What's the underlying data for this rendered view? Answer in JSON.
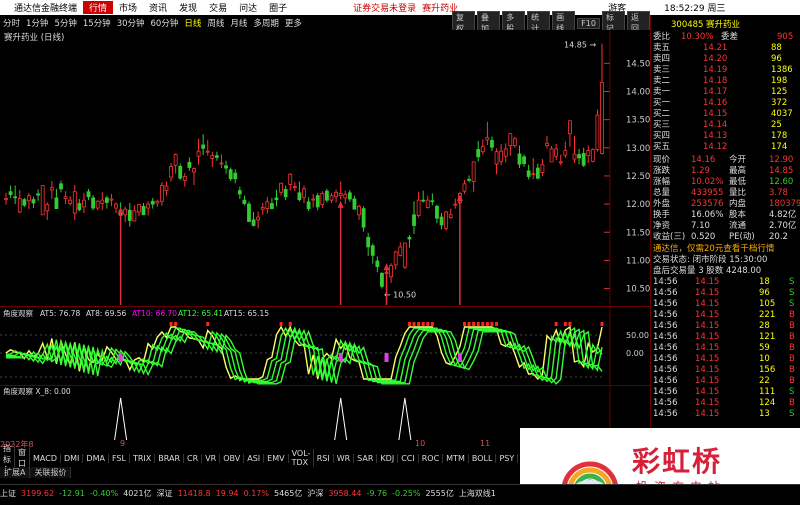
{
  "app": {
    "title": "通达信金融终端",
    "menu": [
      "行情",
      "市场",
      "资讯",
      "发现",
      "交易",
      "问达",
      "圈子"
    ],
    "active_menu": "行情",
    "notice": "证券交易未登录",
    "stock_link": "赛升药业",
    "guest": "游客",
    "time": "18:52:29 周三"
  },
  "toolbar": {
    "periods": [
      "分时",
      "1分钟",
      "5分钟",
      "15分钟",
      "30分钟",
      "60分钟",
      "日线",
      "周线",
      "月线",
      "多周期",
      "更多"
    ],
    "selected": "日线",
    "right_buttons": [
      "复权",
      "叠加",
      "多股",
      "统计",
      "画线",
      "F10",
      "标记",
      "返回"
    ]
  },
  "chart_title": "赛升药业 (日线)",
  "chart_data": {
    "type": "candlestick",
    "ylabels": [
      "14.50",
      "14.00",
      "13.50",
      "13.00",
      "12.50",
      "12.00",
      "11.50",
      "11.00",
      "10.50"
    ],
    "ylim": [
      10.35,
      14.95
    ],
    "high_label": "14.85",
    "low_label": "10.50",
    "candles": [
      [
        12.08,
        12.2,
        11.99,
        12.1
      ],
      [
        12.22,
        12.33,
        12.11,
        12.17
      ],
      [
        12.13,
        12.33,
        12.0,
        12.12
      ],
      [
        11.86,
        12.25,
        11.84,
        12.1
      ],
      [
        12.08,
        12.11,
        11.95,
        11.98
      ],
      [
        12.06,
        12.2,
        11.91,
        12.15
      ],
      [
        12.08,
        12.13,
        11.93,
        12.02
      ],
      [
        12.18,
        12.26,
        12.06,
        12.16
      ],
      [
        11.81,
        12.33,
        11.81,
        12.33
      ],
      [
        11.88,
        12.03,
        11.72,
        11.99
      ],
      [
        12.25,
        12.41,
        12.09,
        12.29
      ],
      [
        12.11,
        12.27,
        11.92,
        11.92
      ],
      [
        12.36,
        12.42,
        12.21,
        12.27
      ],
      [
        12.1,
        12.23,
        12.0,
        12.13
      ],
      [
        12.01,
        12.14,
        11.97,
        12.07
      ],
      [
        11.84,
        12.34,
        11.72,
        12.22
      ],
      [
        12.01,
        12.09,
        11.87,
        11.9
      ],
      [
        11.95,
        12.2,
        11.84,
        12.07
      ],
      [
        12.22,
        12.27,
        12.07,
        12.13
      ],
      [
        12.11,
        12.16,
        11.89,
        11.93
      ],
      [
        11.93,
        12.07,
        11.89,
        12.05
      ],
      [
        12.01,
        12.21,
        11.89,
        12.07
      ],
      [
        12.11,
        12.15,
        11.92,
        12.03
      ],
      [
        12.07,
        12.18,
        11.96,
        12.09
      ],
      [
        11.93,
        12.03,
        11.84,
        12.0
      ],
      [
        11.89,
        12.03,
        11.74,
        11.8
      ],
      [
        11.81,
        11.95,
        11.68,
        11.91
      ],
      [
        11.89,
        12.02,
        11.6,
        11.71
      ],
      [
        11.7,
        11.98,
        11.7,
        11.88
      ],
      [
        11.86,
        12.0,
        11.79,
        11.99
      ],
      [
        11.96,
        12.02,
        11.81,
        11.81
      ],
      [
        11.93,
        12.05,
        11.8,
        12.0
      ],
      [
        12.05,
        12.11,
        11.92,
        12.0
      ],
      [
        12.02,
        12.08,
        11.95,
        12.05
      ],
      [
        12.05,
        12.39,
        11.97,
        12.33
      ],
      [
        12.24,
        12.4,
        12.15,
        12.32
      ],
      [
        12.48,
        12.73,
        12.4,
        12.67
      ],
      [
        12.69,
        12.9,
        12.54,
        12.88
      ],
      [
        12.67,
        12.72,
        12.43,
        12.46
      ],
      [
        12.42,
        12.55,
        12.31,
        12.49
      ],
      [
        12.74,
        12.83,
        12.59,
        12.65
      ],
      [
        12.57,
        12.65,
        12.34,
        12.63
      ],
      [
        12.85,
        13.16,
        12.7,
        12.94
      ],
      [
        13.05,
        13.24,
        12.87,
        12.99
      ],
      [
        12.93,
        13.14,
        12.86,
        12.94
      ],
      [
        12.81,
        12.93,
        12.66,
        12.86
      ],
      [
        12.86,
        12.93,
        12.77,
        12.83
      ],
      [
        12.73,
        12.88,
        12.64,
        12.73
      ],
      [
        12.68,
        12.77,
        12.54,
        12.64
      ],
      [
        12.61,
        12.65,
        12.41,
        12.45
      ],
      [
        12.55,
        12.62,
        12.37,
        12.45
      ],
      [
        12.24,
        12.31,
        12.09,
        12.18
      ],
      [
        12.07,
        12.15,
        11.98,
        12.01
      ],
      [
        12.0,
        12.05,
        11.69,
        11.69
      ],
      [
        11.72,
        11.86,
        11.6,
        11.62
      ],
      [
        11.72,
        11.87,
        11.57,
        11.77
      ],
      [
        11.91,
        12.02,
        11.81,
        11.94
      ],
      [
        11.92,
        12.13,
        11.83,
        12.04
      ],
      [
        12.01,
        12.11,
        11.91,
        11.92
      ],
      [
        12.11,
        12.25,
        11.96,
        12.08
      ],
      [
        12.21,
        12.38,
        12.15,
        12.37
      ],
      [
        12.26,
        12.33,
        12.07,
        12.13
      ],
      [
        12.35,
        12.55,
        12.24,
        12.53
      ],
      [
        12.3,
        12.39,
        12.23,
        12.31
      ],
      [
        12.2,
        12.4,
        12.05,
        12.08
      ],
      [
        12.12,
        12.33,
        12.02,
        12.27
      ],
      [
        12.04,
        12.12,
        11.88,
        11.92
      ],
      [
        12.08,
        12.18,
        11.94,
        12.09
      ],
      [
        12.15,
        12.2,
        11.89,
        11.95
      ],
      [
        11.99,
        12.23,
        11.93,
        12.19
      ],
      [
        12.23,
        12.27,
        12.03,
        12.07
      ],
      [
        12.07,
        12.2,
        12.02,
        12.15
      ],
      [
        12.13,
        12.26,
        12.03,
        12.21
      ],
      [
        12.15,
        12.4,
        12.08,
        12.19
      ],
      [
        12.11,
        12.24,
        12.0,
        12.17
      ],
      [
        12.2,
        12.25,
        12.04,
        12.09
      ],
      [
        12.09,
        12.15,
        11.91,
        11.91
      ],
      [
        11.81,
        11.99,
        11.72,
        11.96
      ],
      [
        11.92,
        11.96,
        11.51,
        11.59
      ],
      [
        11.41,
        11.49,
        11.08,
        11.24
      ],
      [
        11.26,
        11.3,
        10.94,
        11.09
      ],
      [
        10.99,
        11.07,
        10.79,
        10.89
      ],
      [
        10.77,
        10.79,
        10.5,
        10.54
      ],
      [
        10.77,
        10.94,
        10.74,
        10.79
      ],
      [
        10.71,
        10.95,
        10.6,
        10.91
      ],
      [
        10.92,
        11.17,
        10.84,
        11.15
      ],
      [
        11.09,
        11.32,
        11.07,
        11.24
      ],
      [
        10.88,
        11.31,
        10.85,
        11.31
      ],
      [
        11.41,
        11.45,
        11.23,
        11.38
      ],
      [
        11.81,
        12.05,
        11.47,
        11.62
      ],
      [
        11.8,
        12.22,
        11.76,
        12.07
      ],
      [
        12.07,
        12.24,
        12.03,
        12.06
      ],
      [
        11.94,
        12.15,
        11.92,
        12.07
      ],
      [
        12.06,
        12.19,
        11.98,
        12.05
      ],
      [
        11.96,
        11.99,
        11.66,
        11.75
      ],
      [
        11.77,
        11.84,
        11.55,
        11.63
      ],
      [
        11.57,
        11.88,
        11.53,
        11.86
      ],
      [
        11.76,
        11.92,
        11.74,
        11.81
      ],
      [
        11.99,
        12.1,
        11.92,
        12.0
      ],
      [
        12.02,
        12.22,
        11.97,
        12.19
      ],
      [
        12.23,
        12.43,
        12.18,
        12.36
      ],
      [
        12.44,
        12.51,
        12.39,
        12.43
      ],
      [
        12.4,
        12.76,
        12.22,
        12.75
      ],
      [
        12.97,
        13.12,
        12.76,
        12.84
      ],
      [
        12.93,
        13.15,
        12.88,
        13.02
      ],
      [
        13.14,
        13.46,
        13.05,
        13.18
      ],
      [
        13.13,
        13.2,
        12.94,
        13.01
      ],
      [
        12.71,
        12.99,
        12.53,
        12.93
      ],
      [
        12.76,
        13.07,
        12.69,
        12.94
      ],
      [
        12.85,
        13.08,
        12.74,
        12.98
      ],
      [
        13.04,
        13.26,
        12.86,
        13.25
      ],
      [
        13.04,
        13.19,
        13.0,
        13.16
      ],
      [
        12.89,
        13.04,
        12.64,
        12.71
      ],
      [
        12.84,
        12.88,
        12.66,
        12.72
      ],
      [
        12.59,
        12.7,
        12.44,
        12.49
      ],
      [
        12.53,
        12.82,
        12.44,
        12.54
      ],
      [
        12.64,
        12.72,
        12.44,
        12.46
      ],
      [
        12.56,
        12.8,
        12.5,
        12.7
      ],
      [
        13.04,
        13.21,
        12.99,
        13.08
      ],
      [
        12.75,
        13.03,
        12.75,
        12.98
      ],
      [
        12.85,
        13.07,
        12.78,
        12.98
      ],
      [
        12.74,
        12.88,
        12.69,
        12.75
      ],
      [
        12.87,
        13.11,
        12.82,
        12.95
      ],
      [
        13.25,
        13.48,
        13.02,
        13.48
      ],
      [
        12.8,
        13.21,
        12.73,
        12.89
      ],
      [
        12.88,
        12.98,
        12.71,
        12.82
      ],
      [
        12.9,
        13.0,
        12.66,
        12.69
      ],
      [
        12.86,
        13.04,
        12.73,
        12.95
      ],
      [
        12.76,
        12.99,
        12.74,
        12.97
      ],
      [
        12.97,
        13.68,
        12.93,
        13.58
      ],
      [
        12.9,
        14.85,
        12.88,
        14.16
      ]
    ],
    "arrows": [
      {
        "i": 25,
        "p": 11.95
      },
      {
        "i": 73,
        "p": 12.06
      },
      {
        "i": 83,
        "p": 10.95
      },
      {
        "i": 99,
        "p": 12.18
      }
    ],
    "indicator1": {
      "name": "角度观察",
      "values": {
        "AT5": "76.78",
        "AT8": "69.56",
        "AT10": "66.70",
        "AT12": "65.41",
        "AT15": "65.15"
      },
      "ylabels": [
        "50.00",
        "0.00"
      ]
    },
    "indicator2": {
      "name": "角度观察",
      "values": "X_8: 0.00",
      "spikes": [
        25,
        73,
        87
      ]
    }
  },
  "date_labels": [
    "2022年8",
    "9",
    "10",
    "11"
  ],
  "indicator_tabs": [
    "指标A",
    "窗口",
    "MACD",
    "DMI",
    "DMA",
    "FSL",
    "TRIX",
    "BRAR",
    "CR",
    "VR",
    "OBV",
    "ASI",
    "EMV",
    "VOL-TDX",
    "RSI",
    "WR",
    "SAR",
    "KDJ",
    "CCI",
    "ROC",
    "MTM",
    "BOLL",
    "PSY",
    "MCST",
    "更多"
  ],
  "sub_tabs": [
    "扩展A",
    "关联报价"
  ],
  "stock": {
    "code": "300485",
    "name": "赛升药业",
    "weibi_label": "委比",
    "weibi": "10.30%",
    "weicha_label": "委差",
    "weicha": "905",
    "asks": [
      [
        "卖五",
        "14.21",
        "88"
      ],
      [
        "卖四",
        "14.20",
        "96"
      ],
      [
        "卖三",
        "14.19",
        "1386"
      ],
      [
        "卖二",
        "14.18",
        "198"
      ],
      [
        "卖一",
        "14.17",
        "125"
      ]
    ],
    "bids": [
      [
        "买一",
        "14.16",
        "372"
      ],
      [
        "买二",
        "14.15",
        "4037"
      ],
      [
        "买三",
        "14.14",
        "25"
      ],
      [
        "买四",
        "14.13",
        "178"
      ],
      [
        "买五",
        "14.12",
        "174"
      ]
    ],
    "stats": [
      [
        "现价",
        "14.16",
        "今开",
        "12.90"
      ],
      [
        "涨跌",
        "1.29",
        "最高",
        "14.85"
      ],
      [
        "涨幅",
        "10.02%",
        "最低",
        "12.60"
      ],
      [
        "总量",
        "433955",
        "量比",
        "3.78"
      ],
      [
        "外盘",
        "253576",
        "内盘",
        "180379"
      ],
      [
        "换手",
        "16.06%",
        "股本",
        "4.82亿"
      ],
      [
        "净资",
        "7.10",
        "流通",
        "2.70亿"
      ],
      [
        "收益(三)",
        "0.520",
        "PE(动)",
        "20.2"
      ]
    ],
    "news": "通达信，仅需20元查看千档行情",
    "trade_state": "交易状态: 闭市阶段 15:30:00",
    "after_hours": "盘后交易量 3 股数 4248.00",
    "ticks": [
      [
        "14:56",
        "14.15",
        "18",
        "S"
      ],
      [
        "14:56",
        "14.15",
        "96",
        "S"
      ],
      [
        "14:56",
        "14.15",
        "105",
        "S"
      ],
      [
        "14:56",
        "14.15",
        "221",
        "B"
      ],
      [
        "14:56",
        "14.15",
        "28",
        "B"
      ],
      [
        "14:56",
        "14.15",
        "121",
        "B"
      ],
      [
        "14:56",
        "14.15",
        "59",
        "B"
      ],
      [
        "14:56",
        "14.15",
        "10",
        "B"
      ],
      [
        "14:56",
        "14.15",
        "156",
        "B"
      ],
      [
        "14:56",
        "14.15",
        "22",
        "B"
      ],
      [
        "14:56",
        "14.15",
        "111",
        "S"
      ],
      [
        "14:56",
        "14.15",
        "124",
        "B"
      ],
      [
        "14:56",
        "14.15",
        "13",
        "S"
      ]
    ]
  },
  "status_bar": {
    "sh_label": "上证",
    "sh": "3199.62",
    "sh_chg": "-12.91",
    "sh_pct": "-0.40%",
    "sh_amt": "4021亿",
    "sz_label": "深证",
    "sz": "11418.8",
    "sz_chg": "19.94",
    "sz_pct": "0.17%",
    "sz_amt": "5465亿",
    "hs_label": "沪深",
    "hs": "3958.44",
    "hs_chg": "-9.76",
    "hs_pct": "-0.25%",
    "hs_amt": "2555亿",
    "line_label": "上海双线1"
  },
  "watermark": {
    "brand": "彩虹桥",
    "sub": "投资充电站"
  },
  "colors": {
    "up": "#ff3333",
    "down": "#33cc33",
    "ind_green": "#33ff33",
    "ind_red": "#ff2222",
    "arrow": "#e0303a",
    "spike": "#ffffff"
  }
}
